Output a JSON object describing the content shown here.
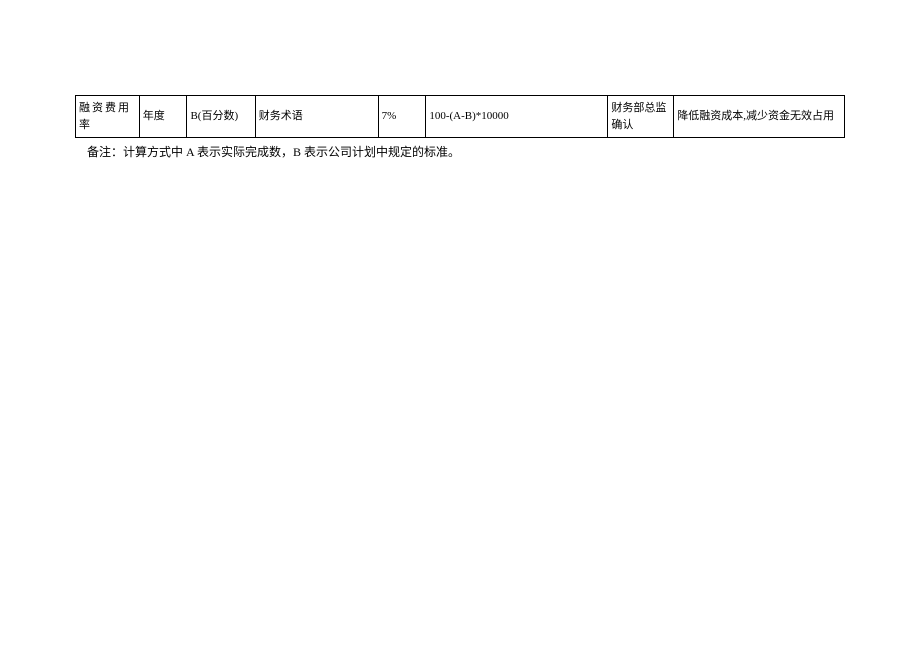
{
  "table": {
    "row": {
      "c1": "融资费用率",
      "c2": "年度",
      "c3": "B(百分数)",
      "c4": "财务术语",
      "c5": "7%",
      "c6": "100-(A-B)*10000",
      "c7": "财务部总监确认",
      "c8": "降低融资成本,减少资金无效占用"
    }
  },
  "remark": "备注：计算方式中 A 表示实际完成数，B 表示公司计划中规定的标准。"
}
